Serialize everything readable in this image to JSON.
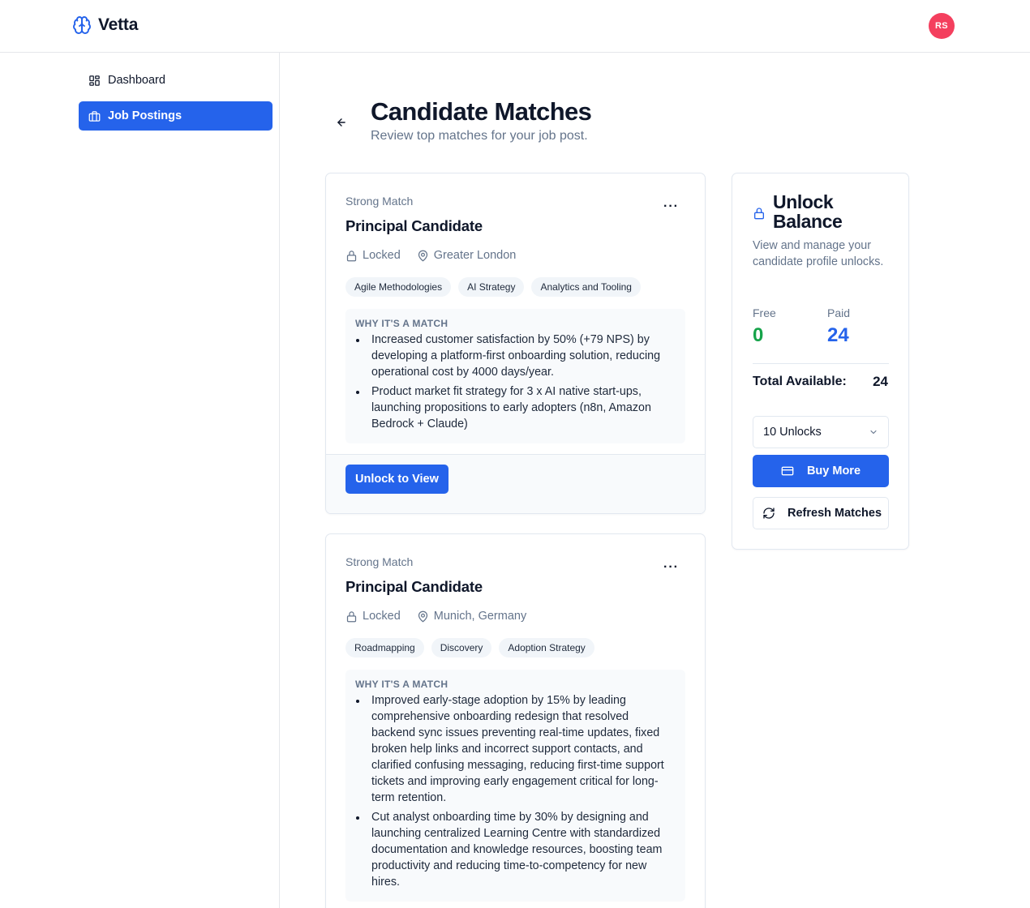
{
  "app": {
    "name": "Vetta",
    "logo_icon": "brain-icon"
  },
  "user": {
    "initials": "RS",
    "avatar_color": "#f43f5e"
  },
  "sidebar": {
    "items": [
      {
        "label": "Dashboard",
        "icon": "dashboard-icon",
        "active": false
      },
      {
        "label": "Job Postings",
        "icon": "briefcase-icon",
        "active": true
      }
    ]
  },
  "page": {
    "title": "Candidate Matches",
    "subtitle": "Review top matches for your job post."
  },
  "candidates": [
    {
      "match": "Strong Match",
      "title": "Principal Candidate",
      "status": "Locked",
      "location": "Greater London",
      "tags": [
        "Agile Methodologies",
        "AI Strategy",
        "Analytics and Tooling"
      ],
      "why_title": "WHY IT'S A MATCH",
      "reasons": [
        "Increased customer satisfaction by 50% (+79 NPS) by developing a platform-first onboarding solution, reducing operational cost by 4000 days/year.",
        "Product market fit strategy for 3 x AI native start-ups, launching propositions to early adopters (n8n, Amazon Bedrock + Claude)"
      ],
      "action": "Unlock to View"
    },
    {
      "match": "Strong Match",
      "title": "Principal Candidate",
      "status": "Locked",
      "location": "Munich, Germany",
      "tags": [
        "Roadmapping",
        "Discovery",
        "Adoption Strategy"
      ],
      "why_title": "WHY IT'S A MATCH",
      "reasons": [
        "Improved early-stage adoption by 15% by leading comprehensive onboarding redesign that resolved backend sync issues preventing real-time updates, fixed broken help links and incorrect support contacts, and clarified confusing messaging, reducing first-time support tickets and improving early engagement critical for long-term retention.",
        "Cut analyst onboarding time by 30% by designing and launching centralized Learning Centre with standardized documentation and knowledge resources, boosting team productivity and reducing time-to-competency for new hires."
      ]
    }
  ],
  "balance": {
    "title": "Unlock Balance",
    "description": "View and manage your candidate profile unlocks.",
    "free_label": "Free",
    "free_value": "0",
    "paid_label": "Paid",
    "paid_value": "24",
    "total_label": "Total Available:",
    "total_value": "24",
    "select_value": "10 Unlocks",
    "buy_label": "Buy More",
    "refresh_label": "Refresh Matches"
  },
  "colors": {
    "primary": "#2563eb",
    "success": "#16a34a",
    "muted": "#64748b",
    "border": "#e2e8f0"
  }
}
